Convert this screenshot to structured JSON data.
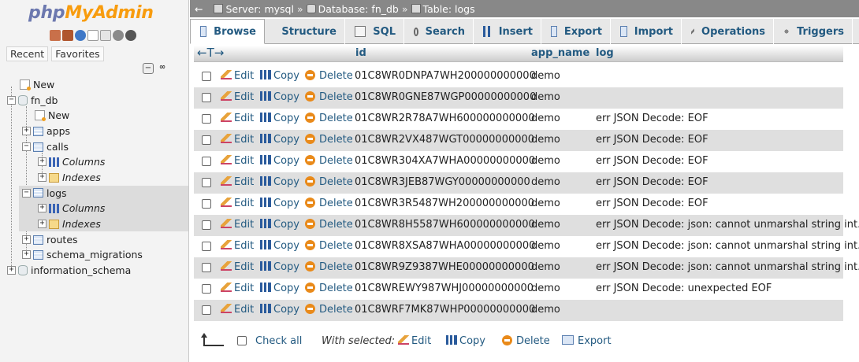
{
  "app": {
    "logo_php": "php",
    "logo_myadmin": "MyAdmin"
  },
  "nav": {
    "recent": "Recent",
    "favorites": "Favorites",
    "tree": [
      {
        "label": "New"
      },
      {
        "label": "fn_db"
      },
      {
        "label": "New"
      },
      {
        "label": "apps"
      },
      {
        "label": "calls"
      },
      {
        "label": "Columns"
      },
      {
        "label": "Indexes"
      },
      {
        "label": "logs"
      },
      {
        "label": "Columns"
      },
      {
        "label": "Indexes"
      },
      {
        "label": "routes"
      },
      {
        "label": "schema_migrations"
      },
      {
        "label": "information_schema"
      }
    ]
  },
  "breadcrumb": {
    "server": "Server: mysql",
    "database": "Database: fn_db",
    "table": "Table: logs",
    "sep": "»"
  },
  "tabs": [
    "Browse",
    "Structure",
    "SQL",
    "Search",
    "Insert",
    "Export",
    "Import",
    "Operations",
    "Triggers"
  ],
  "table": {
    "arrows": "←T→",
    "columns": {
      "id": "id",
      "app_name": "app_name",
      "log": "log"
    },
    "actions": {
      "edit": "Edit",
      "copy": "Copy",
      "delete": "Delete"
    },
    "rows": [
      {
        "id": "01C8WR0DNPA7WH200000000000",
        "app_name": "demo",
        "log": ""
      },
      {
        "id": "01C8WR0GNE87WGP00000000000",
        "app_name": "demo",
        "log": ""
      },
      {
        "id": "01C8WR2R78A7WH600000000000",
        "app_name": "demo",
        "log": "err JSON Decode: EOF"
      },
      {
        "id": "01C8WR2VX487WGT00000000000",
        "app_name": "demo",
        "log": "err JSON Decode: EOF"
      },
      {
        "id": "01C8WR304XA7WHA00000000000",
        "app_name": "demo",
        "log": "err JSON Decode: EOF"
      },
      {
        "id": "01C8WR3JEB87WGY00000000000",
        "app_name": "demo",
        "log": "err JSON Decode: EOF"
      },
      {
        "id": "01C8WR3R5487WH200000000000",
        "app_name": "demo",
        "log": "err JSON Decode: EOF"
      },
      {
        "id": "01C8WR8H5587WH600000000000",
        "app_name": "demo",
        "log": "err JSON Decode: json: cannot unmarshal string int..."
      },
      {
        "id": "01C8WR8XSA87WHA00000000000",
        "app_name": "demo",
        "log": "err JSON Decode: json: cannot unmarshal string int..."
      },
      {
        "id": "01C8WR9Z9387WHE00000000000",
        "app_name": "demo",
        "log": "err JSON Decode: json: cannot unmarshal string int..."
      },
      {
        "id": "01C8WREWY987WHJ00000000000",
        "app_name": "demo",
        "log": "err JSON Decode: unexpected EOF"
      },
      {
        "id": "01C8WRF7MK87WHP00000000000",
        "app_name": "demo",
        "log": ""
      }
    ]
  },
  "footer": {
    "check_all": "Check all",
    "with_selected": "With selected:",
    "edit": "Edit",
    "copy": "Copy",
    "delete": "Delete",
    "export": "Export"
  },
  "colors": {
    "link": "#235a81",
    "logo_blue": "#6c78af",
    "logo_orange": "#f89c0e",
    "row_alt": "#dfdfdf",
    "topbar": "#888888"
  }
}
